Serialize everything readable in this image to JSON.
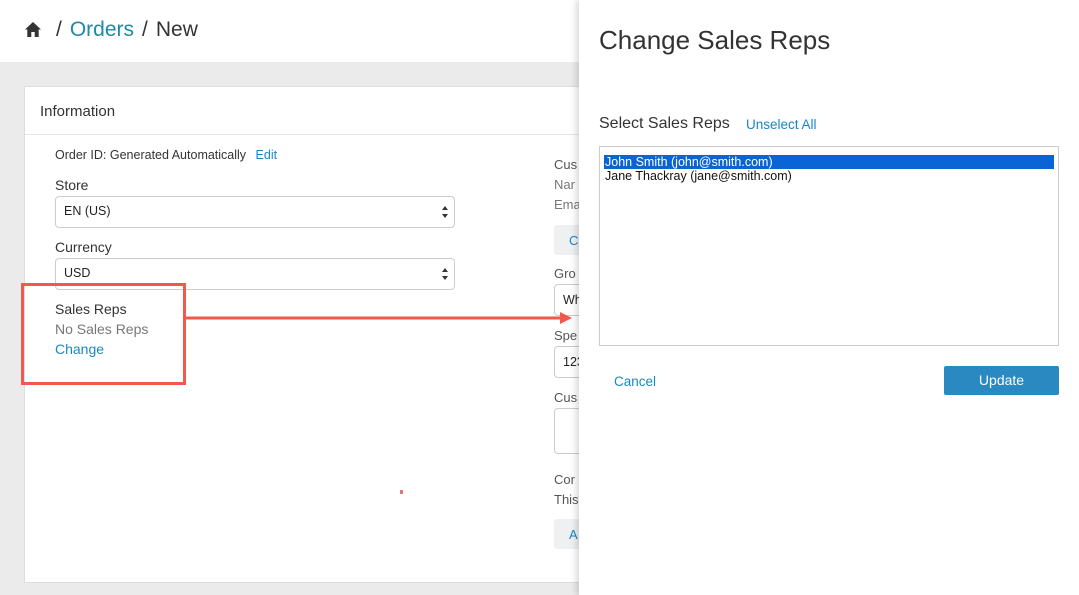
{
  "breadcrumb": {
    "home_icon": "home-icon",
    "orders": "Orders",
    "current": "New",
    "separator": "/"
  },
  "panel": {
    "title": "Information",
    "order_id_text": "Order ID: Generated Automatically",
    "order_id_edit": "Edit",
    "store_label": "Store",
    "store_value": "EN (US)",
    "currency_label": "Currency",
    "currency_value": "USD",
    "sales_reps_label": "Sales Reps",
    "sales_reps_value": "No Sales Reps",
    "sales_reps_change": "Change",
    "right_fragments": {
      "cus": "Cus",
      "nar": "Nar",
      "ema": "Ema",
      "c_btn": "C",
      "gro": "Gro",
      "wh": "Wh",
      "spe": "Spe",
      "num": "123",
      "cus2": "Cus",
      "cor": "Cor",
      "this": "This",
      "a_btn": "A"
    }
  },
  "modal": {
    "title": "Change Sales Reps",
    "select_label": "Select Sales Reps",
    "unselect_all": "Unselect All",
    "options": [
      {
        "label": "John Smith (john@smith.com)",
        "selected": true
      },
      {
        "label": "Jane Thackray (jane@smith.com)",
        "selected": false
      }
    ],
    "cancel": "Cancel",
    "update": "Update"
  },
  "colors": {
    "accent": "#1a87c4",
    "highlight": "#f0594c",
    "update_button": "#2a89c0",
    "selected_option": "#0a64d6"
  }
}
